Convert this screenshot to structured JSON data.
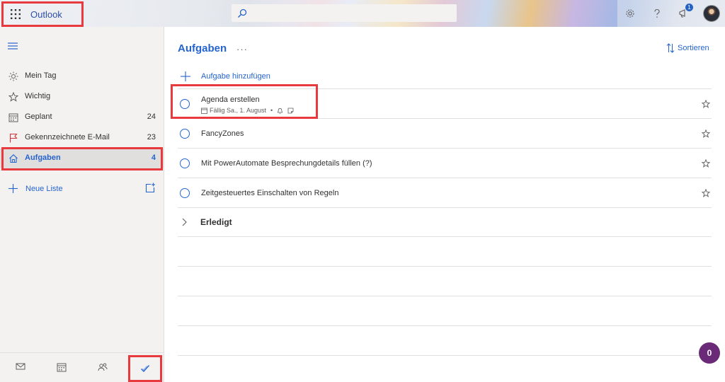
{
  "header": {
    "app_name": "Outlook",
    "search_placeholder": "",
    "notification_count": "1"
  },
  "sidebar": {
    "items": [
      {
        "label": "Mein Tag",
        "count": "",
        "icon": "sun-icon"
      },
      {
        "label": "Wichtig",
        "count": "",
        "icon": "star-icon"
      },
      {
        "label": "Geplant",
        "count": "24",
        "icon": "calendar-icon"
      },
      {
        "label": "Gekennzeichnete E-Mail",
        "count": "23",
        "icon": "flag-icon"
      },
      {
        "label": "Aufgaben",
        "count": "4",
        "icon": "home-icon",
        "selected": true
      }
    ],
    "new_list_label": "Neue Liste"
  },
  "main": {
    "title": "Aufgaben",
    "more_label": "···",
    "sort_label": "Sortieren",
    "add_task_label": "Aufgabe hinzufügen",
    "tasks": [
      {
        "title": "Agenda erstellen",
        "due": "Fällig Sa., 1. August",
        "has_reminder": true,
        "has_note": true
      },
      {
        "title": "FancyZones"
      },
      {
        "title": "Mit PowerAutomate Besprechungdetails füllen (?)"
      },
      {
        "title": "Zeitgesteuertes Einschalten von Regeln"
      }
    ],
    "completed_label": "Erledigt"
  },
  "fab_count": "0",
  "colors": {
    "accent": "#2564cf",
    "highlight": "#e8393f",
    "fab": "#6b2a78"
  }
}
